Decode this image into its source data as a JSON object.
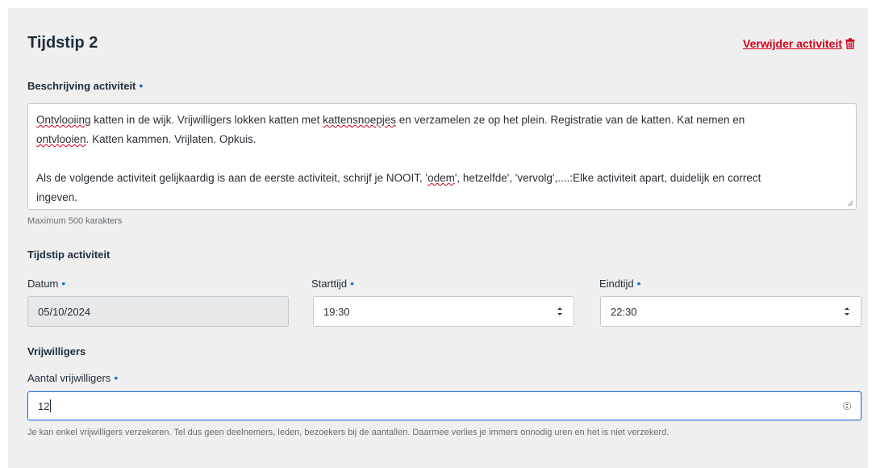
{
  "section": {
    "title": "Tijdstip 2",
    "remove_label": "Verwijder activiteit"
  },
  "description": {
    "label": "Beschrijving activiteit",
    "line1_a": "Ontvlooiing",
    "line1_b": " katten in de wijk. Vrijwilligers lokken katten met ",
    "line1_c": "kattensnoepjes",
    "line1_d": " en verzamelen ze op het plein. Registratie van de katten. Kat nemen en",
    "line2_a": "ontvlooien",
    "line2_b": ". Katten kammen. Vrijlaten. Opkuis.",
    "line3_a": "Als de volgende activiteit gelijkaardig is aan de eerste activiteit, schrijf je NOOIT, '",
    "line3_b": "odem",
    "line3_c": "', hetzelfde', 'vervolg',....:Elke activiteit apart, duidelijk en correct",
    "line4": "ingeven.",
    "hint": "Maximum 500 karakters"
  },
  "time": {
    "heading": "Tijdstip activiteit",
    "date_label": "Datum",
    "date_value": "05/10/2024",
    "start_label": "Starttijd",
    "start_value": "19:30",
    "end_label": "Eindtijd",
    "end_value": "22:30"
  },
  "volunteers": {
    "heading": "Vrijwilligers",
    "count_label": "Aantal vrijwilligers",
    "count_value": "12",
    "hint": "Je kan enkel vrijwilligers verzekeren. Tel dus geen deelnemers, leden, bezoekers bij de aantallen. Daarmee verlies je immers onnodig uren en het is niet verzekerd."
  },
  "icons": {
    "remove": "trash-icon",
    "required": "required-dot-icon",
    "select": "select-arrows-icon",
    "number": "number-stepper-icon",
    "resize": "resize-grip-icon"
  },
  "colors": {
    "danger": "#d0021b",
    "accent": "#2a6fd6",
    "panel": "#efefef"
  }
}
